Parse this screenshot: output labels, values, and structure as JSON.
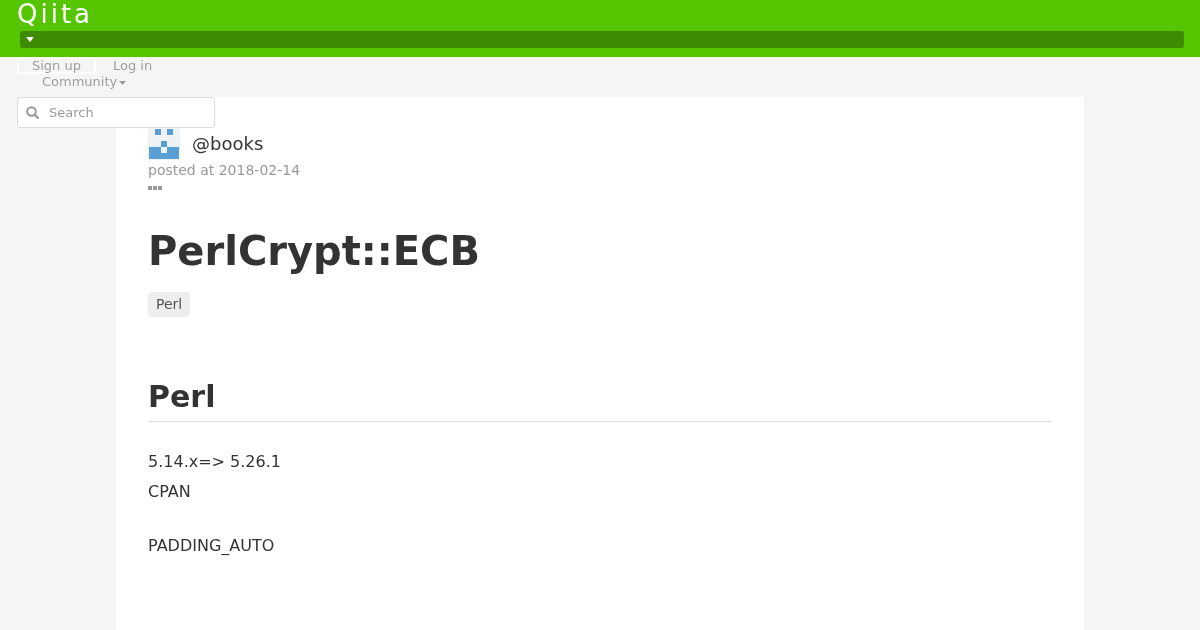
{
  "header": {
    "logo": "Qiita"
  },
  "account": {
    "sign_up": "Sign up",
    "log_in": "Log in"
  },
  "community_menu": {
    "label": "Community"
  },
  "search": {
    "placeholder": "Search"
  },
  "article": {
    "author": "@books",
    "posted": "posted at 2018-02-14",
    "title": "PerlCrypt::ECB",
    "tags": [
      "Perl"
    ],
    "sections": [
      {
        "heading": "Perl",
        "paragraphs": [
          {
            "lines": [
              "5.14.x=> 5.26.1",
              "CPAN"
            ]
          },
          {
            "lines": [
              "PADDING_AUTO"
            ]
          }
        ]
      }
    ]
  }
}
